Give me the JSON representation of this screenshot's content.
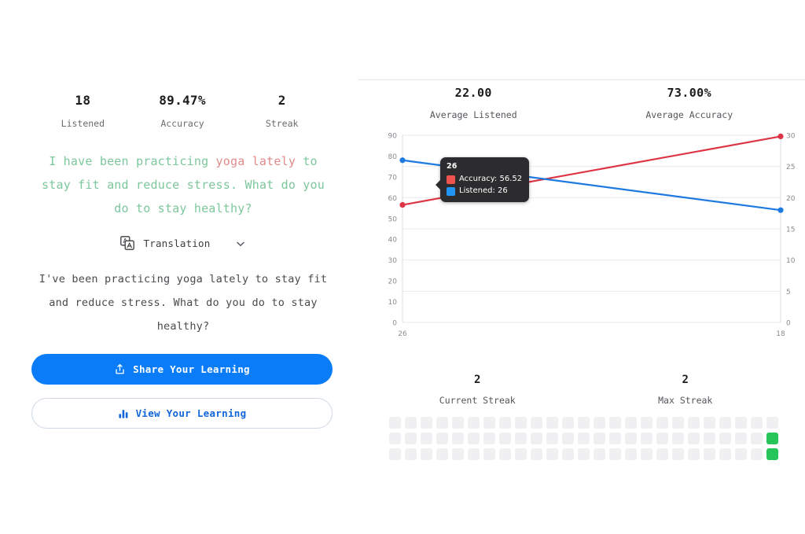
{
  "left": {
    "stats": [
      {
        "value": "18",
        "label": "Listened"
      },
      {
        "value": "89.47%",
        "label": "Accuracy"
      },
      {
        "value": "2",
        "label": "Streak"
      }
    ],
    "sentence": {
      "part1": "I have been practicing ",
      "highlight": "yoga lately",
      "part2": " to stay fit and reduce stress. What do you do to stay healthy?",
      "base_color": "#7cc79c",
      "highlight_color": "#e08b8b"
    },
    "translation": {
      "icon": "translate-icon",
      "label": "Translation",
      "chevron": "chevron-down-icon",
      "text": "I've been practicing yoga lately to stay fit and reduce stress. What do you do to stay healthy?"
    },
    "buttons": {
      "share": {
        "label": "Share Your Learning",
        "icon": "share-upload-icon",
        "bg": "#0a7cf7",
        "fg": "#ffffff"
      },
      "view": {
        "label": "View Your Learning",
        "icon": "bar-chart-icon",
        "bg": "#ffffff",
        "fg": "#1166d8"
      }
    }
  },
  "right": {
    "averages": [
      {
        "value": "22.00",
        "label": "Average Listened"
      },
      {
        "value": "73.00%",
        "label": "Average Accuracy"
      }
    ],
    "tooltip": {
      "title": "26",
      "rows": [
        {
          "label": "Accuracy: 56.52",
          "color": "#ef5350"
        },
        {
          "label": "Listened: 26",
          "color": "#2196f3"
        }
      ]
    },
    "streaks": [
      {
        "value": "2",
        "label": "Current Streak"
      },
      {
        "value": "2",
        "label": "Max Streak"
      }
    ],
    "heatmap": {
      "rows": 3,
      "cols": 25,
      "empty_color": "#f0f0f2",
      "active_color": "#25c55a",
      "active_cells": [
        [
          1,
          24
        ],
        [
          2,
          24
        ]
      ]
    }
  },
  "chart_data": {
    "type": "line",
    "title": "",
    "xlabel": "",
    "ylabel": "",
    "x": [
      "26",
      "18"
    ],
    "categories": [
      "26",
      "18"
    ],
    "series": [
      {
        "name": "Accuracy",
        "color": "#dc3545",
        "axis": "left",
        "values": [
          56.52,
          89.47
        ],
        "point_labels": [
          "56.52",
          "89.47"
        ]
      },
      {
        "name": "Listened",
        "color": "#1f7ae0",
        "axis": "right",
        "values": [
          26,
          18
        ],
        "point_labels": [
          "26",
          "18"
        ]
      }
    ],
    "left_axis": {
      "ticks": [
        90,
        80,
        70,
        60,
        50,
        40,
        30,
        20,
        10,
        0
      ],
      "ylim": [
        0,
        90
      ],
      "label": ""
    },
    "right_axis": {
      "ticks": [
        30,
        25,
        20,
        15,
        10,
        5,
        0
      ],
      "ylim": [
        0,
        30
      ],
      "label": ""
    },
    "x_tick_labels": [
      "26",
      "18"
    ],
    "grid": true,
    "legend": "none"
  }
}
